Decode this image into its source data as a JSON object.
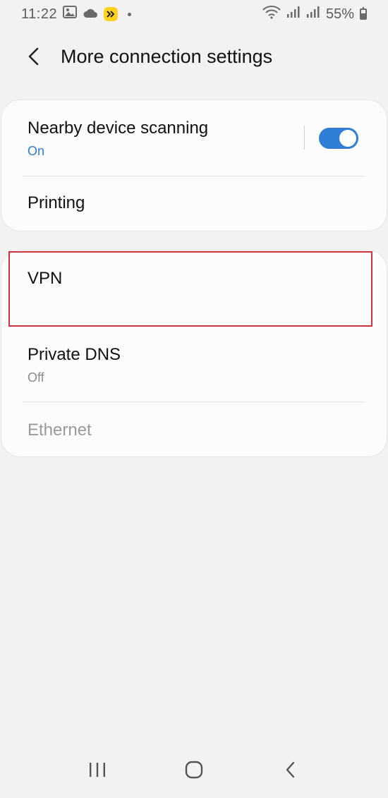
{
  "status_bar": {
    "time": "11:22",
    "battery_percent": "55%",
    "battery_level": 0.55,
    "icons": [
      "gallery-icon",
      "cloud-icon",
      "app-badge-icon",
      "notification-dot-icon",
      "wifi-icon",
      "signal-icon-1",
      "signal-icon-2",
      "battery-icon"
    ]
  },
  "header": {
    "title": "More connection settings",
    "back_icon": "chevron-left-icon"
  },
  "card1": {
    "nearby": {
      "title": "Nearby device scanning",
      "status": "On",
      "toggle_on": true
    },
    "printing": {
      "title": "Printing"
    }
  },
  "card2": {
    "vpn": {
      "title": "VPN"
    },
    "private_dns": {
      "title": "Private DNS",
      "status": "Off"
    },
    "ethernet": {
      "title": "Ethernet",
      "disabled": true
    }
  },
  "colors": {
    "accent": "#2f7dd6",
    "highlight": "#d0313c",
    "background": "#f2f2f2",
    "card": "#fcfcfc",
    "disabled_text": "#9a9a9a",
    "secondary_text": "#8a8a8a"
  },
  "nav_bar": {
    "icons": [
      "recent-apps-icon",
      "home-icon",
      "back-icon"
    ]
  }
}
